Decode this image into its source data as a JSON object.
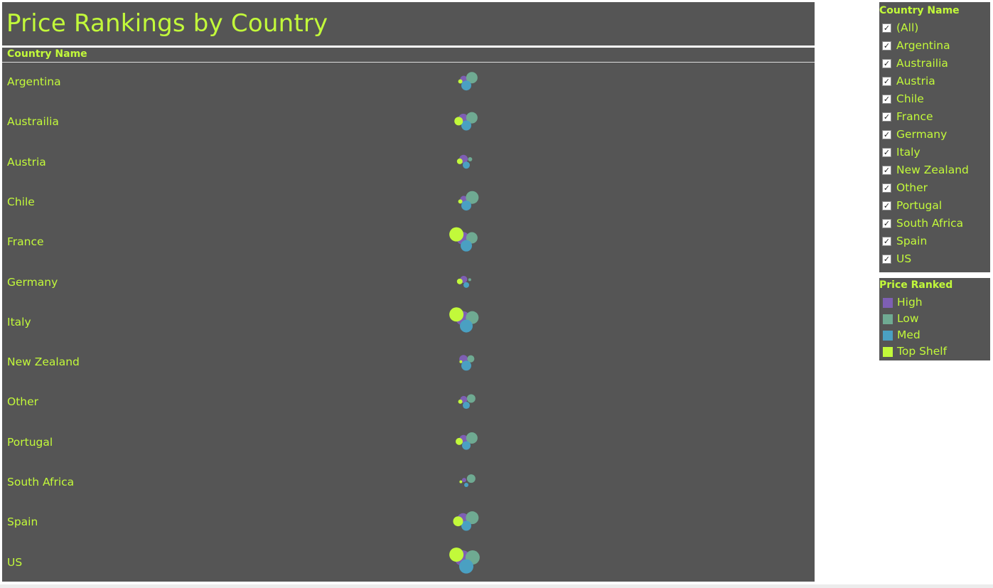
{
  "title": "Price Rankings by Country",
  "column_header": "Country Name",
  "chart_data": {
    "type": "bubble",
    "title": "Price Rankings by Country",
    "categories": [
      "Argentina",
      "Austrailia",
      "Austria",
      "Chile",
      "France",
      "Germany",
      "Italy",
      "New Zealand",
      "Other",
      "Portugal",
      "South Africa",
      "Spain",
      "US"
    ],
    "series": [
      {
        "name": "High",
        "color": "#7e5fb3",
        "values": [
          5,
          7,
          6,
          5,
          9,
          5,
          10,
          6,
          5,
          6,
          3,
          8,
          11
        ]
      },
      {
        "name": "Low",
        "color": "#6faa92",
        "values": [
          8,
          8,
          3,
          9,
          8,
          2,
          9,
          5,
          6,
          8,
          6,
          9,
          10
        ]
      },
      {
        "name": "Med",
        "color": "#4aa0c2",
        "values": [
          7,
          7,
          5,
          7,
          8,
          4,
          9,
          7,
          5,
          6,
          3,
          7,
          10
        ]
      },
      {
        "name": "Top Shelf",
        "color": "#c2f93a",
        "values": [
          3,
          6,
          4,
          3,
          10,
          4,
          10,
          2,
          3,
          5,
          2,
          7,
          10
        ]
      }
    ],
    "legend_position": "right",
    "grid": false
  },
  "filter": {
    "title": "Country Name",
    "items": [
      {
        "label": "(All)",
        "checked": true
      },
      {
        "label": "Argentina",
        "checked": true
      },
      {
        "label": "Austrailia",
        "checked": true
      },
      {
        "label": "Austria",
        "checked": true
      },
      {
        "label": "Chile",
        "checked": true
      },
      {
        "label": "France",
        "checked": true
      },
      {
        "label": "Germany",
        "checked": true
      },
      {
        "label": "Italy",
        "checked": true
      },
      {
        "label": "New Zealand",
        "checked": true
      },
      {
        "label": "Other",
        "checked": true
      },
      {
        "label": "Portugal",
        "checked": true
      },
      {
        "label": "South Africa",
        "checked": true
      },
      {
        "label": "Spain",
        "checked": true
      },
      {
        "label": "US",
        "checked": true
      }
    ]
  },
  "legend": {
    "title": "Price Ranked",
    "items": [
      {
        "label": "High",
        "color": "#7e5fb3"
      },
      {
        "label": "Low",
        "color": "#6faa92"
      },
      {
        "label": "Med",
        "color": "#4aa0c2"
      },
      {
        "label": "Top Shelf",
        "color": "#c2f93a"
      }
    ]
  }
}
